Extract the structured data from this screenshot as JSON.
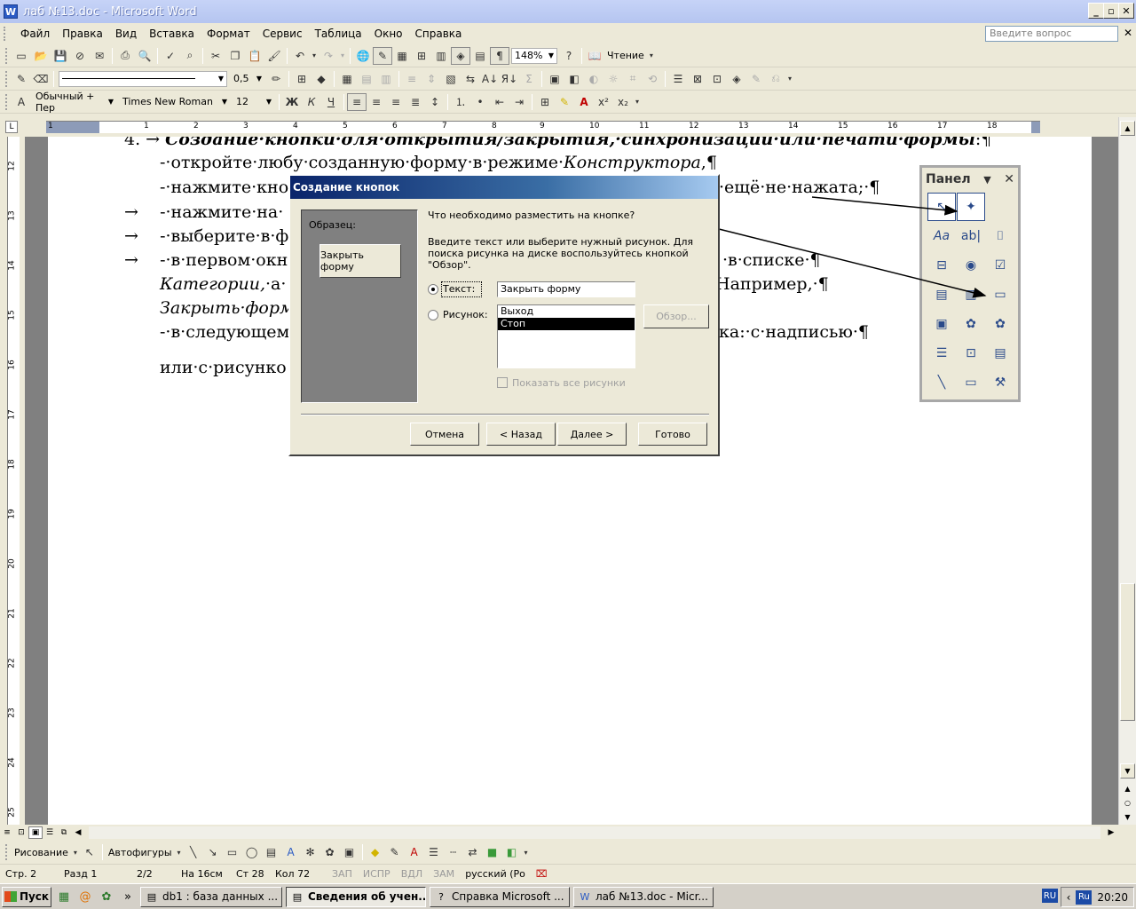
{
  "window": {
    "title": "лаб №13.doc - Microsoft Word",
    "app_icon": "W"
  },
  "menu": {
    "items": [
      "Файл",
      "Правка",
      "Вид",
      "Вставка",
      "Формат",
      "Сервис",
      "Таблица",
      "Окно",
      "Справка"
    ],
    "ask_placeholder": "Введите вопрос"
  },
  "toolbar_standard": {
    "zoom": "148%",
    "reading_label": "Чтение"
  },
  "toolbar_drawing_lines": {
    "line_weight": "0,5"
  },
  "toolbar_format": {
    "style": "Обычный + Пер",
    "font": "Times New Roman",
    "size": "12"
  },
  "ruler": {
    "numbers": [
      "1",
      "2",
      "1",
      "2",
      "3",
      "4",
      "5",
      "6",
      "7",
      "8",
      "9",
      "10",
      "11",
      "12",
      "13",
      "14",
      "15",
      "16",
      "17",
      "18"
    ]
  },
  "vruler": {
    "numbers": [
      "12",
      "13",
      "14",
      "15",
      "16",
      "17",
      "18",
      "19",
      "20",
      "21",
      "22",
      "23",
      "24",
      "25"
    ]
  },
  "document": {
    "line1_num": "4.",
    "line1": "Создание·кнопки·для·открытия/закрытия,·синхронизации·или·печати·формы",
    "line1_end": ":¶",
    "line2_a": "-·откройте·любу·созданную·форму·в·режиме·",
    "line2_b": "Конструктора",
    "line2_c": ",¶",
    "line3_a": "-·нажмите·кно",
    "line3_b": "·ещё·не·нажата;·¶",
    "line4_a": "-·нажмите·на·",
    "line5_a": "-·выберите·в·ф",
    "line6_a": "-·в·первом·окн",
    "line6_b": "·в·списке·¶",
    "line7_a": "Категории,",
    "line7_b": "·а·",
    "line7_c": "Например,·¶",
    "line8_a": "Закрыть·форм",
    "line9_a": "-·в·следующем",
    "line9_b": "ка:·с·надписью·¶",
    "line10_a": "или·с·рисунко"
  },
  "toolbox": {
    "title": "Панел"
  },
  "dialog": {
    "title": "Создание кнопок",
    "sample_label": "Образец:",
    "sample_button": "Закрыть форму",
    "question": "Что необходимо разместить на кнопке?",
    "instruction": "Введите текст или выберите нужный рисунок.  Для поиска рисунка на диске воспользуйтесь кнопкой \"Обзор\".",
    "text_option": "Текст:",
    "text_value": "Закрыть форму",
    "picture_option": "Рисунок:",
    "pictures": [
      "Выход",
      "Стоп"
    ],
    "selected_picture": "Стоп",
    "browse": "Обзор...",
    "show_all": "Показать все рисунки",
    "cancel": "Отмена",
    "back": "< Назад",
    "next": "Далее >",
    "finish": "Готово"
  },
  "drawing": {
    "draw_label": "Рисование",
    "autoshapes_label": "Автофигуры"
  },
  "status": {
    "page": "Стр. 2",
    "section": "Разд 1",
    "pages": "2/2",
    "at": "На 16см",
    "line": "Ст 28",
    "col": "Кол 72",
    "rec": "ЗАП",
    "trk": "ИСПР",
    "ext": "ВДЛ",
    "ovr": "ЗАМ",
    "lang": "русский (Ро"
  },
  "taskbar": {
    "start": "Пуск",
    "tasks": [
      {
        "label": "db1 : база данных ...",
        "active": false
      },
      {
        "label": "Сведения об учен...",
        "active": true
      },
      {
        "label": "Справка Microsoft ...",
        "active": false
      },
      {
        "label": "лаб №13.doc - Micr...",
        "active": false
      }
    ],
    "lang": "Ru",
    "lang_left": "RU",
    "time": "20:20"
  }
}
